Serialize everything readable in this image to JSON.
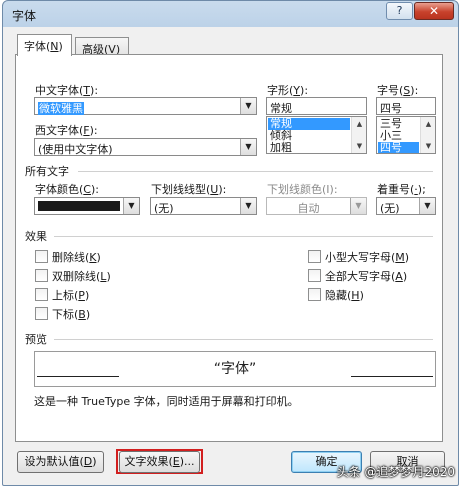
{
  "window": {
    "title": "字体",
    "help_glyph": "?",
    "close_glyph": "✕"
  },
  "tabs": [
    {
      "label": "字体(",
      "key": "N",
      "suffix": ")"
    },
    {
      "label": "高级(",
      "key": "V",
      "suffix": ")"
    }
  ],
  "font": {
    "chinese_label": "中文字体(",
    "chinese_key": "T",
    "chinese_suffix": "):",
    "chinese_value": "微软雅黑",
    "western_label": "西文字体(",
    "western_key": "F",
    "western_suffix": "):",
    "western_value": "(使用中文字体)",
    "style_label": "字形(",
    "style_key": "Y",
    "style_suffix": "):",
    "style_value": "常规",
    "style_options": [
      "常规",
      "倾斜",
      "加粗"
    ],
    "size_label": "字号(",
    "size_key": "S",
    "size_suffix": "):",
    "size_value": "四号",
    "size_options": [
      "三号",
      "小三",
      "四号"
    ]
  },
  "all_text": {
    "title": "所有文字",
    "color_label": "字体颜色(",
    "color_key": "C",
    "color_suffix": "):",
    "color_value": "#1a1a1a",
    "underline_label": "下划线线型(",
    "underline_key": "U",
    "underline_suffix": "):",
    "underline_value": "(无)",
    "underline_color_label": "下划线颜色(I):",
    "underline_color_value": "自动",
    "emphasis_label": "着重号(",
    "emphasis_key": "·",
    "emphasis_suffix": ");",
    "emphasis_value": "(无)"
  },
  "effects": {
    "title": "效果",
    "left": [
      {
        "label": "删除线(",
        "key": "K",
        "suffix": ")"
      },
      {
        "label": "双删除线(",
        "key": "L",
        "suffix": ")"
      },
      {
        "label": "上标(",
        "key": "P",
        "suffix": ")"
      },
      {
        "label": "下标(",
        "key": "B",
        "suffix": ")"
      }
    ],
    "right": [
      {
        "label": "小型大写字母(",
        "key": "M",
        "suffix": ")"
      },
      {
        "label": "全部大写字母(",
        "key": "A",
        "suffix": ")"
      },
      {
        "label": "隐藏(",
        "key": "H",
        "suffix": ")"
      }
    ]
  },
  "preview": {
    "title": "预览",
    "sample": "“字体”",
    "description": "这是一种 TrueType 字体，同时适用于屏幕和打印机。"
  },
  "buttons": {
    "set_default": "设为默认值(",
    "set_default_key": "D",
    "set_default_suffix": ")",
    "text_effects": "文字效果(",
    "text_effects_key": "E",
    "text_effects_suffix": ")...",
    "ok": "确定",
    "cancel": "取消"
  },
  "watermark": "头条 @追梦梦月2020"
}
